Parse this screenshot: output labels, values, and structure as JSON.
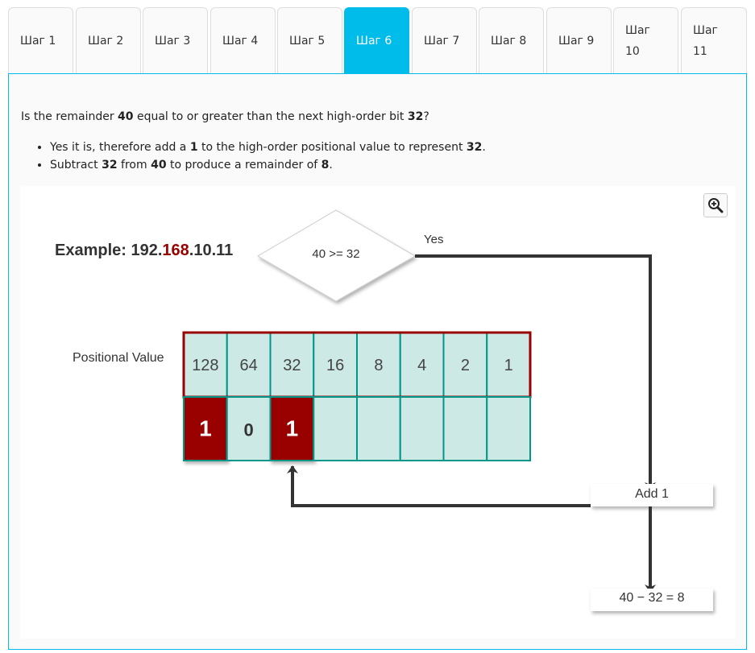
{
  "tabs": [
    {
      "label": "Шаг 1",
      "active": false
    },
    {
      "label": "Шаг 2",
      "active": false
    },
    {
      "label": "Шаг 3",
      "active": false
    },
    {
      "label": "Шаг 4",
      "active": false
    },
    {
      "label": "Шаг 5",
      "active": false
    },
    {
      "label": "Шаг 6",
      "active": true
    },
    {
      "label": "Шаг 7",
      "active": false
    },
    {
      "label": "Шаг 8",
      "active": false
    },
    {
      "label": "Шаг 9",
      "active": false
    },
    {
      "label": "Шаг 10",
      "active": false
    },
    {
      "label": "Шаг 11",
      "active": false
    }
  ],
  "content": {
    "question": {
      "before": "Is the remainder ",
      "remainder": "40",
      "middle": " equal to or greater than the next high-order bit ",
      "bit": "32",
      "after": "?"
    },
    "bullets": [
      {
        "p1": "Yes it is, therefore add a ",
        "b1": "1",
        "p2": " to the high-order positional value to represent ",
        "b2": "32",
        "p3": "."
      },
      {
        "p1": "Subtract ",
        "b1": "32",
        "p2": " from ",
        "b2": "40",
        "p3": " to produce a remainder of ",
        "b3": "8",
        "p4": "."
      }
    ]
  },
  "diagram": {
    "example_label": "Example: ",
    "ip_part1": "192.",
    "ip_highlight": "168",
    "ip_part2": ".10.11",
    "decision": "40 >= 32",
    "yes_label": "Yes",
    "positional_label": "Positional Value",
    "positional_values": [
      "128",
      "64",
      "32",
      "16",
      "8",
      "4",
      "2",
      "1"
    ],
    "bits": [
      "1",
      "0",
      "1",
      "",
      "",
      "",
      "",
      ""
    ],
    "add_label": "Add 1",
    "subtract_label": "40 − 32 = 8",
    "colors": {
      "highlight": "#990000",
      "cell": "#cde9e6",
      "cell_border": "#009688",
      "header_border": "#990000",
      "arrow": "#333333"
    }
  },
  "icons": {
    "zoom": "zoom-in-icon"
  }
}
